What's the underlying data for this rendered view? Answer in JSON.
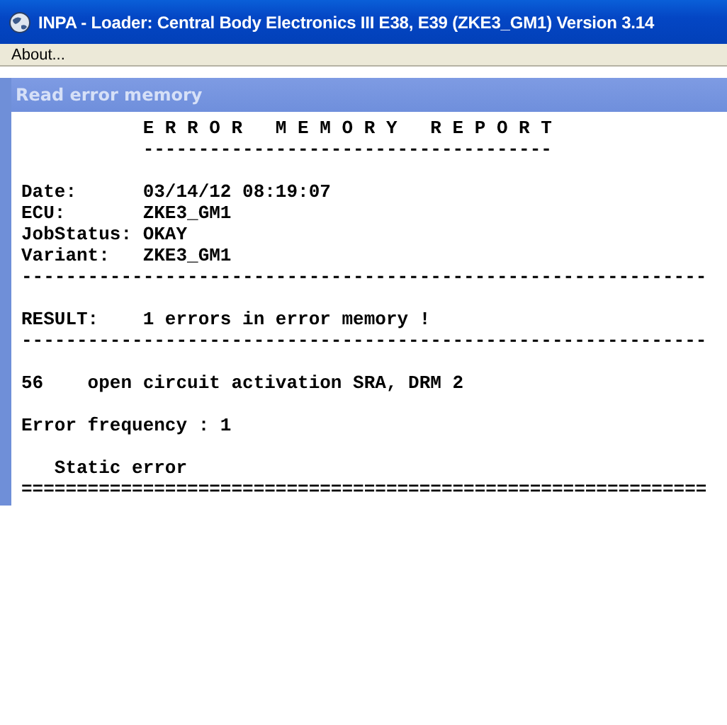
{
  "window": {
    "title": "INPA - Loader:  Central Body Electronics III E38, E39 (ZKE3_GM1) Version 3.14"
  },
  "menu": [
    "About..."
  ],
  "child_window": {
    "title": "Read error memory",
    "report_blocks": [
      [
        "           E R R O R   M E M O R Y   R E P O R T",
        "           -------------------------------------"
      ],
      [
        "Date:      03/14/12 08:19:07",
        "ECU:       ZKE3_GM1",
        "JobStatus: OKAY",
        "Variant:   ZKE3_GM1",
        "--------------------------------------------------------------"
      ],
      [
        "RESULT:    1 errors in error memory !",
        "--------------------------------------------------------------"
      ],
      [
        "56    open circuit activation SRA, DRM 2"
      ],
      [
        "Error frequency : 1"
      ],
      [
        "   Static error",
        "=============================================================="
      ]
    ]
  }
}
